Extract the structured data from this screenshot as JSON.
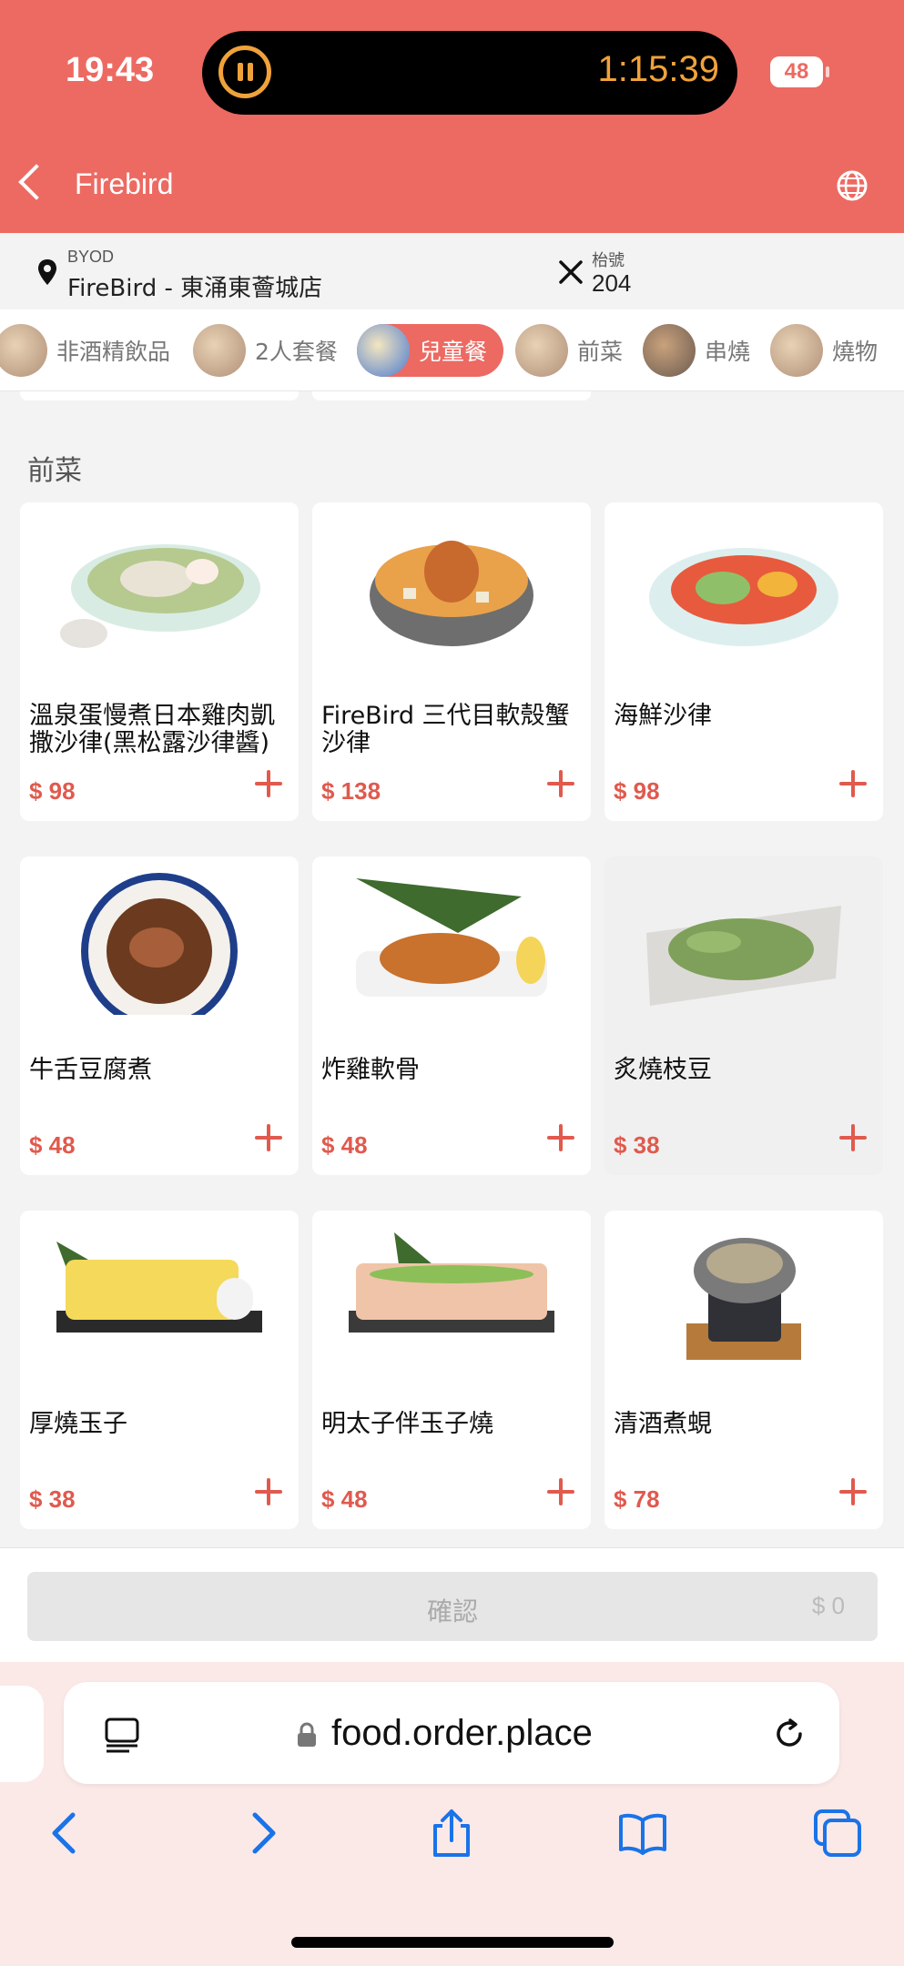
{
  "status": {
    "time": "19:43",
    "timer": "1:15:39",
    "battery": "48"
  },
  "header": {
    "title": "Firebird"
  },
  "info": {
    "mode": "BYOD",
    "store": "FireBird - 東涌東薈城店",
    "table_label": "枱號",
    "table_number": "204"
  },
  "categories": [
    {
      "label": "非酒精飲品",
      "active": false
    },
    {
      "label": "2人套餐",
      "active": false
    },
    {
      "label": "兒童餐",
      "active": true
    },
    {
      "label": "前菜",
      "active": false
    },
    {
      "label": "串燒",
      "active": false
    },
    {
      "label": "燒物",
      "active": false
    }
  ],
  "section": {
    "title": "前菜"
  },
  "items": [
    {
      "name": "溫泉蛋慢煮日本雞肉凱撒沙律(黑松露沙律醬)",
      "price": "$ 98"
    },
    {
      "name": "FireBird 三代目軟殼蟹沙律",
      "price": "$ 138"
    },
    {
      "name": "海鮮沙律",
      "price": "$ 98"
    },
    {
      "name": "牛舌豆腐煮",
      "price": "$ 48"
    },
    {
      "name": "炸雞軟骨",
      "price": "$ 48"
    },
    {
      "name": "炙燒枝豆",
      "price": "$ 38"
    },
    {
      "name": "厚燒玉子",
      "price": "$ 38"
    },
    {
      "name": "明太子伴玉子燒",
      "price": "$ 48"
    },
    {
      "name": "清酒煮蜆",
      "price": "$ 78"
    }
  ],
  "confirm": {
    "label": "確認",
    "total": "$ 0"
  },
  "browser": {
    "url": "food.order.place"
  },
  "colors": {
    "brand": "#ec6a62",
    "price": "#e05a4e"
  },
  "icons": [
    "back-chevron-icon",
    "globe-icon",
    "pin-icon",
    "utensils-icon",
    "plus-icon",
    "reader-icon",
    "lock-icon",
    "reload-icon",
    "back-icon",
    "forward-icon",
    "share-icon",
    "bookmarks-icon",
    "tabs-icon"
  ]
}
